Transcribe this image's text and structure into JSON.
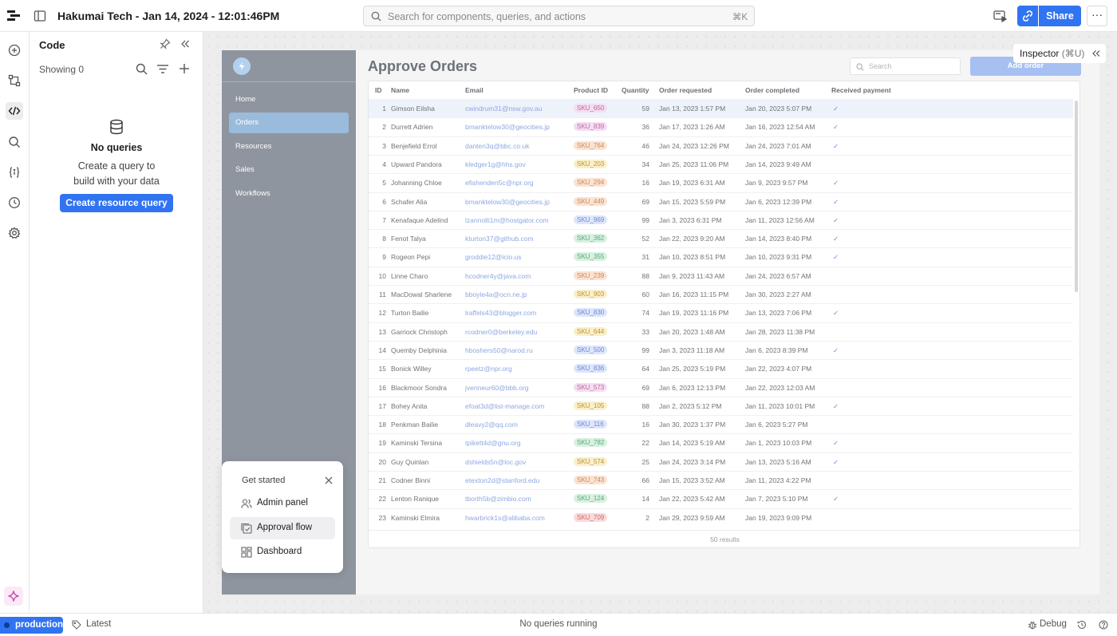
{
  "topbar": {
    "title": "Hakumai Tech - Jan 14, 2024 - 12:01:46PM",
    "search_placeholder": "Search for components, queries, and actions",
    "search_shortcut": "⌘K",
    "share_label": "Share",
    "more_label": "···"
  },
  "code_panel": {
    "title": "Code",
    "showing": "Showing 0",
    "empty_title": "No queries",
    "empty_hint_line1": "Create a query to",
    "empty_hint_line2": "build with your data",
    "create_button": "Create resource query"
  },
  "app": {
    "nav": [
      "Home",
      "Orders",
      "Resources",
      "Sales",
      "Workflows"
    ],
    "active_nav": "Orders",
    "title": "Approve Orders",
    "search_placeholder": "Search",
    "add_order_label": "Add order",
    "columns": [
      "ID",
      "Name",
      "Email",
      "Product ID",
      "Quantity",
      "Order requested",
      "Order completed",
      "Received payment"
    ],
    "rows": [
      {
        "id": "1",
        "name": "Gimson Eilsha",
        "email": "cwindrum31@nsw.gov.au",
        "sku": "SKU_650",
        "tag": "pink",
        "qty": "59",
        "requested": "Jan 13, 2023 1:57 PM",
        "completed": "Jan 20, 2023 5:07 PM",
        "paid": "✓"
      },
      {
        "id": "2",
        "name": "Durrett Adrien",
        "email": "bmanktelow30@geocities.jp",
        "sku": "SKU_839",
        "tag": "pink",
        "qty": "36",
        "requested": "Jan 17, 2023 1:26 AM",
        "completed": "Jan 16, 2023 12:54 AM",
        "paid": "✓"
      },
      {
        "id": "3",
        "name": "Benjefield Errol",
        "email": "danten3q@bbc.co.uk",
        "sku": "SKU_764",
        "tag": "orange",
        "qty": "46",
        "requested": "Jan 24, 2023 12:26 PM",
        "completed": "Jan 24, 2023 7:01 AM",
        "paid": "✓"
      },
      {
        "id": "4",
        "name": "Upward Pandora",
        "email": "kledger1g@hhs.gov",
        "sku": "SKU_203",
        "tag": "yellow",
        "qty": "34",
        "requested": "Jan 25, 2023 11:06 PM",
        "completed": "Jan 14, 2023 9:49 AM",
        "paid": ""
      },
      {
        "id": "5",
        "name": "Johanning Chloe",
        "email": "efishenden5c@npr.org",
        "sku": "SKU_294",
        "tag": "orange",
        "qty": "16",
        "requested": "Jan 19, 2023 6:31 AM",
        "completed": "Jan 9, 2023 9:57 PM",
        "paid": "✓"
      },
      {
        "id": "6",
        "name": "Schafer Alia",
        "email": "bmanktelow30@geocities.jp",
        "sku": "SKU_449",
        "tag": "orange",
        "qty": "69",
        "requested": "Jan 15, 2023 5:59 PM",
        "completed": "Jan 6, 2023 12:39 PM",
        "paid": "✓"
      },
      {
        "id": "7",
        "name": "Kenafaque Adelind",
        "email": "lzannolli1m@hostgator.com",
        "sku": "SKU_969",
        "tag": "blue",
        "qty": "99",
        "requested": "Jan 3, 2023 6:31 PM",
        "completed": "Jan 11, 2023 12:56 AM",
        "paid": "✓"
      },
      {
        "id": "8",
        "name": "Fenot Talya",
        "email": "kturton37@github.com",
        "sku": "SKU_362",
        "tag": "green",
        "qty": "52",
        "requested": "Jan 22, 2023 9:20 AM",
        "completed": "Jan 14, 2023 8:40 PM",
        "paid": "✓"
      },
      {
        "id": "9",
        "name": "Rogeon Pepi",
        "email": "groddie12@icio.us",
        "sku": "SKU_355",
        "tag": "green",
        "qty": "31",
        "requested": "Jan 10, 2023 8:51 PM",
        "completed": "Jan 10, 2023 9:31 PM",
        "paid": "✓"
      },
      {
        "id": "10",
        "name": "Linne Charo",
        "email": "hcodner4y@java.com",
        "sku": "SKU_239",
        "tag": "orange",
        "qty": "88",
        "requested": "Jan 9, 2023 11:43 AM",
        "completed": "Jan 24, 2023 6:57 AM",
        "paid": ""
      },
      {
        "id": "11",
        "name": "MacDowal Sharlene",
        "email": "bboyle4a@ocn.ne.jp",
        "sku": "SKU_903",
        "tag": "yellow",
        "qty": "60",
        "requested": "Jan 16, 2023 11:15 PM",
        "completed": "Jan 30, 2023 2:27 AM",
        "paid": ""
      },
      {
        "id": "12",
        "name": "Turton Bailie",
        "email": "lraffels43@blogger.com",
        "sku": "SKU_830",
        "tag": "blue",
        "qty": "74",
        "requested": "Jan 19, 2023 11:16 PM",
        "completed": "Jan 13, 2023 7:06 PM",
        "paid": "✓"
      },
      {
        "id": "13",
        "name": "Garriock Christoph",
        "email": "rcodner0@berkeley.edu",
        "sku": "SKU_644",
        "tag": "yellow",
        "qty": "33",
        "requested": "Jan 20, 2023 1:48 AM",
        "completed": "Jan 28, 2023 11:38 PM",
        "paid": ""
      },
      {
        "id": "14",
        "name": "Quemby Delphinia",
        "email": "hboshers50@narod.ru",
        "sku": "SKU_500",
        "tag": "blue",
        "qty": "99",
        "requested": "Jan 3, 2023 11:18 AM",
        "completed": "Jan 6, 2023 8:39 PM",
        "paid": "✓"
      },
      {
        "id": "15",
        "name": "Bonick Willey",
        "email": "rpeetz@npr.org",
        "sku": "SKU_836",
        "tag": "blue",
        "qty": "64",
        "requested": "Jan 25, 2023 5:19 PM",
        "completed": "Jan 22, 2023 4:07 PM",
        "paid": ""
      },
      {
        "id": "16",
        "name": "Blackmoor Sondra",
        "email": "jvenneur60@bbb.org",
        "sku": "SKU_573",
        "tag": "pink",
        "qty": "69",
        "requested": "Jan 6, 2023 12:13 PM",
        "completed": "Jan 22, 2023 12:03 AM",
        "paid": ""
      },
      {
        "id": "17",
        "name": "Bohey Anita",
        "email": "efoat3d@list-manage.com",
        "sku": "SKU_105",
        "tag": "yellow",
        "qty": "88",
        "requested": "Jan 2, 2023 5:12 PM",
        "completed": "Jan 11, 2023 10:01 PM",
        "paid": "✓"
      },
      {
        "id": "18",
        "name": "Penkman Bailie",
        "email": "dleavy2@qq.com",
        "sku": "SKU_116",
        "tag": "blue",
        "qty": "16",
        "requested": "Jan 30, 2023 1:37 PM",
        "completed": "Jan 6, 2023 5:27 PM",
        "paid": ""
      },
      {
        "id": "19",
        "name": "Kaminski Tersina",
        "email": "tpikett4d@gnu.org",
        "sku": "SKU_782",
        "tag": "green",
        "qty": "22",
        "requested": "Jan 14, 2023 5:19 AM",
        "completed": "Jan 1, 2023 10:03 PM",
        "paid": "✓"
      },
      {
        "id": "20",
        "name": "Guy Quinlan",
        "email": "dshields5n@loc.gov",
        "sku": "SKU_574",
        "tag": "yellow",
        "qty": "25",
        "requested": "Jan 24, 2023 3:14 PM",
        "completed": "Jan 13, 2023 5:16 AM",
        "paid": "✓"
      },
      {
        "id": "21",
        "name": "Codner Binni",
        "email": "etexton2d@stanford.edu",
        "sku": "SKU_743",
        "tag": "orange",
        "qty": "66",
        "requested": "Jan 15, 2023 3:52 AM",
        "completed": "Jan 11, 2023 4:22 PM",
        "paid": ""
      },
      {
        "id": "22",
        "name": "Lenton Ranique",
        "email": "tborth5b@zimbio.com",
        "sku": "SKU_124",
        "tag": "green",
        "qty": "14",
        "requested": "Jan 22, 2023 5:42 AM",
        "completed": "Jan 7, 2023 5:10 PM",
        "paid": "✓"
      },
      {
        "id": "23",
        "name": "Kaminski Elmira",
        "email": "hwarbrick1s@alibaba.com",
        "sku": "SKU_709",
        "tag": "red",
        "qty": "2",
        "requested": "Jan 29, 2023 9:59 AM",
        "completed": "Jan 19, 2023 9:09 PM",
        "paid": ""
      }
    ],
    "results": "50 results"
  },
  "tag_colors": {
    "pink": {
      "bg": "#f5ddf0",
      "fg": "#b86aa6"
    },
    "orange": {
      "bg": "#fbe3d1",
      "fg": "#c98a5e"
    },
    "yellow": {
      "bg": "#fbefc9",
      "fg": "#b8963b"
    },
    "blue": {
      "bg": "#dde6fb",
      "fg": "#6f8ad1"
    },
    "green": {
      "bg": "#d8f1e1",
      "fg": "#5ea57a"
    },
    "red": {
      "bg": "#fbdada",
      "fg": "#cf6a6a"
    }
  },
  "inspector": {
    "label": "Inspector",
    "shortcut": "(⌘U)"
  },
  "get_started": {
    "title": "Get started",
    "items": [
      "Admin panel",
      "Approval flow",
      "Dashboard"
    ]
  },
  "statusbar": {
    "env": "production",
    "version": "Latest",
    "status": "No queries running",
    "debug": "Debug"
  },
  "colors": {
    "accent": "#3174f1"
  }
}
